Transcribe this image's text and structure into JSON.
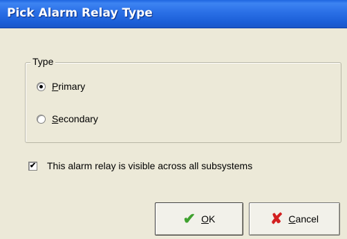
{
  "window": {
    "title": "Pick Alarm Relay Type"
  },
  "group": {
    "legend": "Type",
    "options": [
      {
        "mnemonic": "P",
        "rest": "rimary",
        "selected": true
      },
      {
        "mnemonic": "S",
        "rest": "econdary",
        "selected": false
      }
    ]
  },
  "checkbox": {
    "label": "This alarm relay is visible across all subsystems",
    "checked": true,
    "mark": "✔"
  },
  "buttons": {
    "ok": {
      "icon": "✔",
      "mnemonic": "O",
      "rest": "K"
    },
    "cancel": {
      "icon": "✘",
      "mnemonic": "C",
      "rest": "ancel"
    }
  },
  "colors": {
    "titlebar": "#2a6fe6",
    "dialog": "#ece9d8",
    "ok_icon": "#3fa12f",
    "cancel_icon": "#d32020"
  }
}
